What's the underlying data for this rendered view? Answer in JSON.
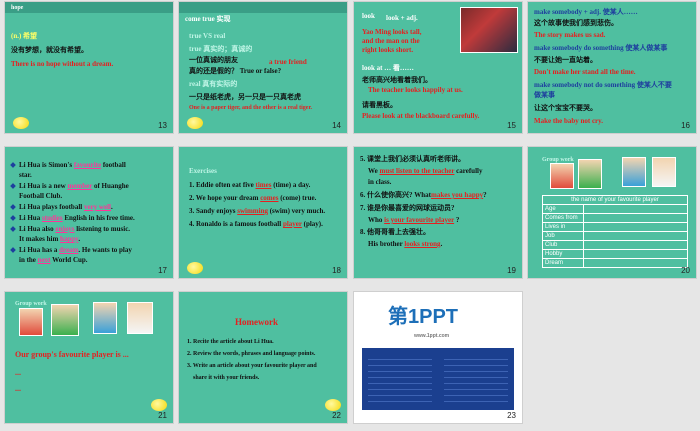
{
  "slides": [
    {
      "num": "13",
      "lines": {
        "l1": "hope",
        "l2": "(n.) 希望",
        "l3": "没有梦想，就没有希望。",
        "l4": "There is no hope without a dream."
      }
    },
    {
      "num": "14",
      "lines": {
        "l1": "come true 实现",
        "l2": "true VS real",
        "l3": "true 真实的；真诚的",
        "l4": "一位真诚的朋友",
        "l4b": "a true friend",
        "l5": "真的还是假的？ True or false?",
        "l6": "real 真有实际的",
        "l7": "一只是纸老虎，另一只是一只真老虎",
        "l8": "One is a paper tiger, and the other is a real tiger."
      }
    },
    {
      "num": "15",
      "lines": {
        "l1": "look",
        "l1b": "look + adj.",
        "l2": "Yao Ming looks tall,",
        "l3": "and the man on the",
        "l4": "right looks short.",
        "l5": "look at … 看……",
        "l6": "老师高兴地看着我们。",
        "l7": "The teacher looks happily at us.",
        "l8": "请看黑板。",
        "l9": "Please look at the blackboard carefully."
      }
    },
    {
      "num": "16",
      "lines": {
        "l1": "make somebody + adj. 使某人……",
        "l2": "这个故事使我们感到悲伤。",
        "l3": "The story makes us sad.",
        "l4": "make somebody do something 使某人做某事",
        "l5": "不要让她一直站着。",
        "l6": "Don't make her stand all the time.",
        "l7": "make somebody not do something 使某人不要",
        "l7b": "做某事",
        "l8": "让这个宝宝不要哭。",
        "l9": "Make the baby not cry."
      }
    },
    {
      "num": "17",
      "lines": {
        "a1": "Li Hua is Simon's",
        "a1f": "favourite",
        "a1e": "football",
        "a2": "star.",
        "b1": "Li Hua is a new",
        "b1f": "member",
        "b1e": "of Huanghe",
        "b2": "Football Club.",
        "c1": "Li Hua plays football",
        "c1f": "very well",
        "c1e": ".",
        "d1": "Li Hua",
        "d1f": "studies",
        "d1e": "English in his free time.",
        "e1": "Li Hua also",
        "e1f": "enjoys",
        "e1e": "listening to music.",
        "e2": "It makes him",
        "e2f": "happy",
        "e2e": ".",
        "f1": "Li Hua has a",
        "f1f": "dream",
        "f1e": ". He wants to play",
        "f2": "in the",
        "f2f": "next",
        "f2e": "World Cup."
      }
    },
    {
      "num": "18",
      "lines": {
        "h": "Exercises",
        "e1": "1. Eddie often eat five",
        "e1f": "times",
        "e1e": "(time) a day.",
        "e2": "2. We hope your dream",
        "e2f": "comes",
        "e2e": "(come) true.",
        "e3": "3. Sandy enjoys",
        "e3f": "swimming",
        "e3e": "(swim) very much.",
        "e4": "4. Ronaldo is a famous football",
        "e4f": "player",
        "e4e": "(play)."
      }
    },
    {
      "num": "19",
      "lines": {
        "q5": "5. 课堂上我们必须认真听老师讲。",
        "q5a": "We",
        "q5f": "must listen to the teacher",
        "q5e": "carefully",
        "q5b": "in class.",
        "q6": "6. 什么使你高兴? What",
        "q6f": "makes you happy",
        "q6e": "?",
        "q7": "7. 谁是你最喜爱的网球运动员?",
        "q7a": "Who",
        "q7f": "is your favourite player",
        "q7e": "?",
        "q8": "8. 他哥哥看上去强壮。",
        "q8a": "His brother",
        "q8f": "looks strong",
        "q8e": "."
      }
    },
    {
      "num": "20",
      "lines": {
        "gw": "Group work",
        "cap": "the name of your favourite player",
        "rows": [
          "Age",
          "Comes from",
          "Lives in",
          "Job",
          "Club",
          "Hobby",
          "Dream"
        ]
      }
    },
    {
      "num": "21",
      "lines": {
        "gw": "Group work",
        "t1": "Our group's favourite player is ...",
        "t2": "...",
        "t3": "..."
      }
    },
    {
      "num": "22",
      "lines": {
        "h": "Homework",
        "i1": "1. Recite the article about Li Hua.",
        "i2": "2. Review the words, phrases and language points.",
        "i3": "3. Write an article about your favourite player and",
        "i3b": "share it with your friends."
      }
    },
    {
      "num": "23",
      "lines": {
        "logo": "第1PPT",
        "url": "www.1ppt.com"
      }
    }
  ]
}
